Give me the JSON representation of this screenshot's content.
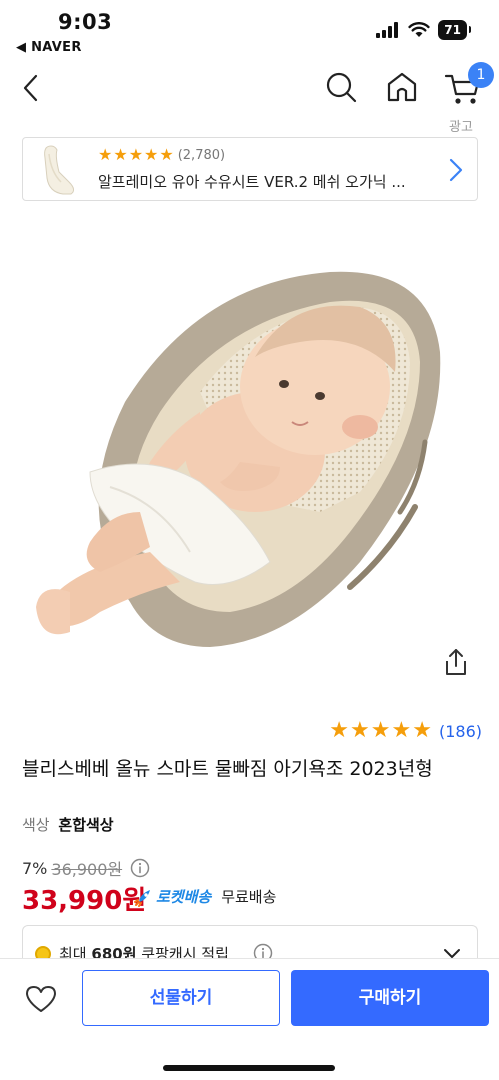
{
  "status_bar": {
    "time": "9:03",
    "back_app": "◀ NAVER",
    "battery": "71"
  },
  "nav": {
    "cart_count": "1",
    "ad_label": "광고"
  },
  "ad": {
    "rating_count": "(2,780)",
    "title": "알프레미오 유아 수유시트 VER.2 메쉬 오가닉 ...",
    "stars": 5
  },
  "product": {
    "rating_count": "(186)",
    "stars": 5,
    "title": "블리스베베 올뉴 스마트 물빠짐 아기욕조 2023년형",
    "option_label": "색상",
    "option_value": "혼합색상",
    "discount": "7%",
    "original_price": "36,900원",
    "price": "33,990원",
    "rocket_label": "로켓배송",
    "shipping": "무료배송",
    "cash_prefix": "최대",
    "cash_amount": "680원",
    "cash_suffix": "쿠팡캐시 적립"
  },
  "bottom": {
    "gift_label": "선물하기",
    "buy_label": "구매하기"
  },
  "colors": {
    "accent": "#346aff",
    "price": "#d0021b",
    "star": "#f59e0b",
    "rocket": "#1e88e5"
  },
  "icons": [
    "back-arrow-icon",
    "search-icon",
    "home-icon",
    "cart-icon",
    "chevron-right-icon",
    "share-icon",
    "info-icon",
    "coin-icon",
    "chevron-down-icon",
    "heart-icon",
    "rocket-icon"
  ]
}
